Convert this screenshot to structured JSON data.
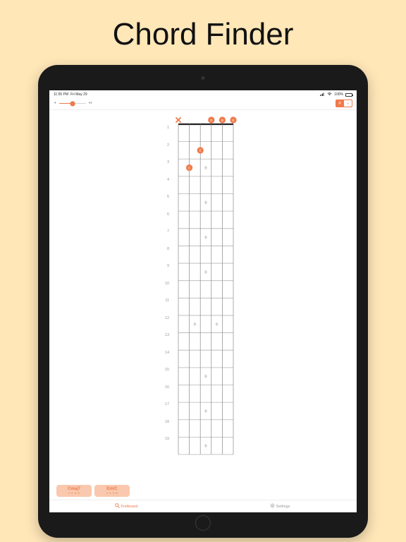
{
  "heading": "Chord Finder",
  "status_bar": {
    "time": "11:55 PM",
    "date": "Fri May 29",
    "signal_icon": "signal-icon",
    "wifi_icon": "wifi-icon",
    "battery_pct": "100%"
  },
  "toolbar": {
    "vol_low_icon": "speaker-low-icon",
    "vol_high_icon": "speaker-high-icon",
    "slider_value_pct": 50,
    "btn_sharp_label": "#",
    "btn_flat_label": "♭"
  },
  "fretboard": {
    "num_strings": 6,
    "num_frets": 19,
    "fret_labels": [
      "1",
      "2",
      "3",
      "4",
      "5",
      "6",
      "7",
      "8",
      "9",
      "10",
      "11",
      "12",
      "13",
      "14",
      "15",
      "16",
      "17",
      "18",
      "19"
    ],
    "inlay_single_frets": [
      3,
      5,
      7,
      9,
      15,
      17,
      19
    ],
    "inlay_double_fret": 12,
    "open_markers": [
      {
        "string": 0,
        "type": "x",
        "label": ""
      },
      {
        "string": 3,
        "type": "note",
        "label": "G"
      },
      {
        "string": 4,
        "type": "note",
        "label": "B"
      },
      {
        "string": 5,
        "type": "note",
        "label": "E"
      }
    ],
    "finger_dots": [
      {
        "string": 2,
        "fret": 2,
        "label": "E"
      },
      {
        "string": 1,
        "fret": 3,
        "label": "C"
      }
    ],
    "accent_color": "#f07a49"
  },
  "chord_results": [
    {
      "name": "Cmaj7",
      "notes": "C E G B"
    },
    {
      "name": "Em/C",
      "notes": "C E G B"
    }
  ],
  "tab_bar": {
    "fretboard_label": "Fretboard",
    "settings_label": "Settings",
    "fretboard_icon": "search-icon",
    "settings_icon": "gear-icon"
  }
}
